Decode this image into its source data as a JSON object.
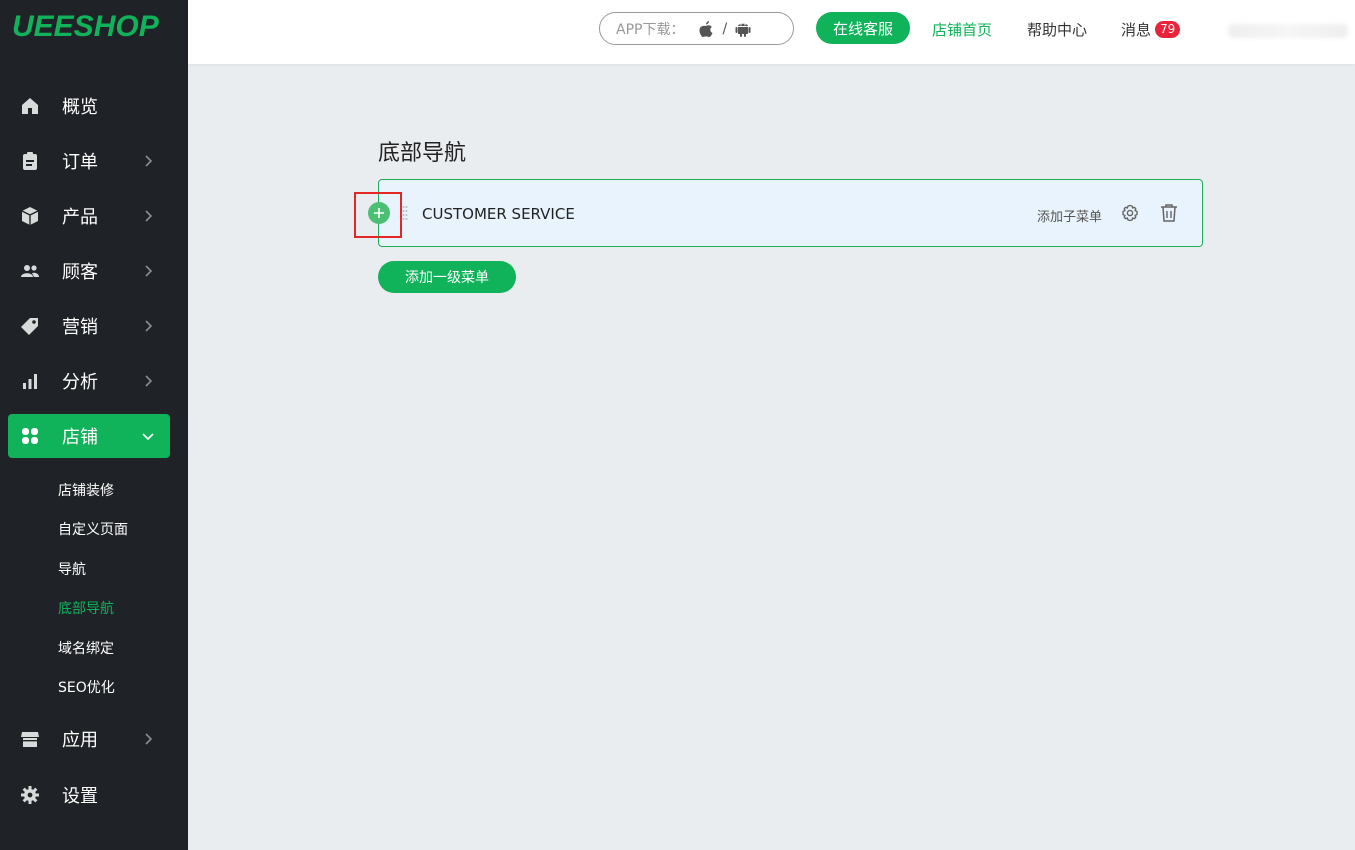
{
  "sidebar": {
    "logo": "UEESHOP",
    "items": [
      {
        "label": "概览",
        "icon": "home-icon"
      },
      {
        "label": "订单",
        "icon": "clipboard-icon"
      },
      {
        "label": "产品",
        "icon": "box-icon"
      },
      {
        "label": "顾客",
        "icon": "users-icon"
      },
      {
        "label": "营销",
        "icon": "tag-icon"
      },
      {
        "label": "分析",
        "icon": "bar-chart-icon"
      },
      {
        "label": "店铺",
        "icon": "grid-icon"
      },
      {
        "label": "应用",
        "icon": "store-icon"
      },
      {
        "label": "设置",
        "icon": "gear-icon"
      }
    ],
    "sub_items": [
      {
        "label": "店铺装修"
      },
      {
        "label": "自定义页面"
      },
      {
        "label": "导航"
      },
      {
        "label": "底部导航"
      },
      {
        "label": "域名绑定"
      },
      {
        "label": "SEO优化"
      }
    ]
  },
  "header": {
    "app_download_label": "APP下载：",
    "app_download_sep": "/",
    "online_service": "在线客服",
    "store_home": "店铺首页",
    "help_center": "帮助中心",
    "messages": "消息",
    "message_count": "79"
  },
  "main": {
    "title": "底部导航",
    "menu_items": [
      {
        "name": "CUSTOMER SERVICE",
        "add_submenu": "添加子菜单"
      }
    ],
    "add_top_menu": "添加一级菜单"
  },
  "colors": {
    "brand": "#10b25a",
    "sidebar_bg": "#1f2327",
    "card_bg": "#e9f3fd",
    "badge": "#e8233a",
    "highlight": "#e32626"
  }
}
